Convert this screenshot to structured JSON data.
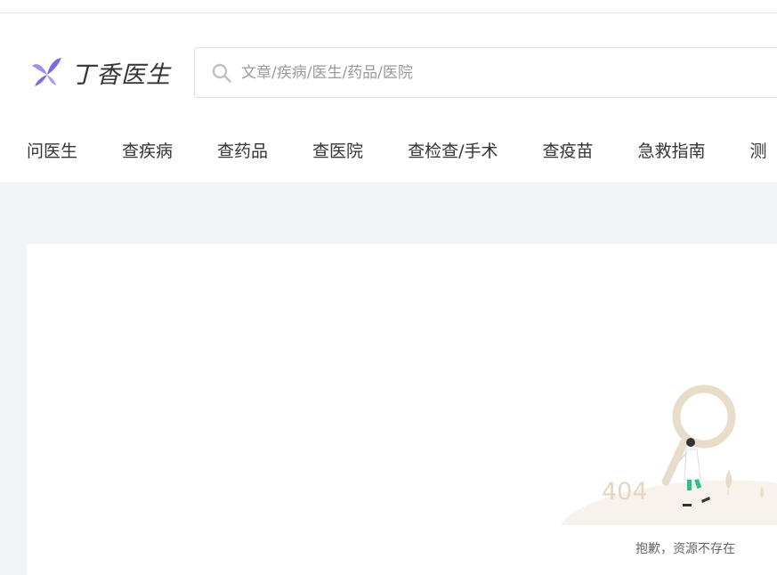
{
  "header": {
    "logo_text": "丁香医生",
    "search": {
      "placeholder": "文章/疾病/医生/药品/医院",
      "value": ""
    }
  },
  "nav": {
    "items": [
      {
        "label": "问医生"
      },
      {
        "label": "查疾病"
      },
      {
        "label": "查药品"
      },
      {
        "label": "查医院"
      },
      {
        "label": "查检查/手术"
      },
      {
        "label": "查疫苗"
      },
      {
        "label": "急救指南"
      },
      {
        "label": "测"
      }
    ]
  },
  "error": {
    "code": "404",
    "message": "抱歉，资源不存在"
  },
  "colors": {
    "brand_purple": "#7b6be0",
    "page_background": "#f2f3f5",
    "illustration_beige": "#e8dccb",
    "accent_green": "#2cc08e"
  }
}
